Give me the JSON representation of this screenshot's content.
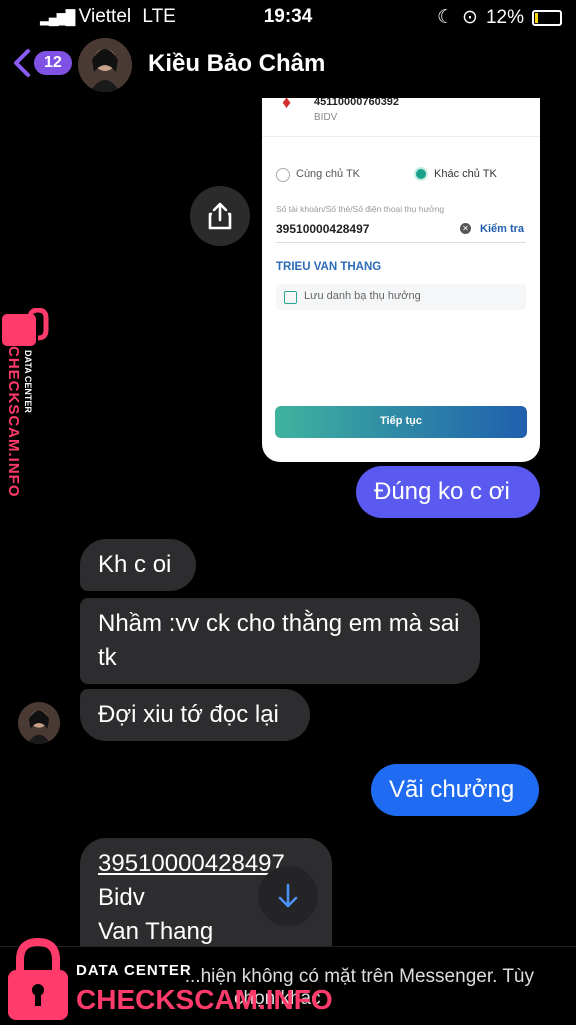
{
  "status_bar": {
    "carrier": "Viettel",
    "network": "LTE",
    "time": "19:34",
    "battery": "12%"
  },
  "header": {
    "back_count": "12",
    "contact_name": "Kiều Bảo Châm"
  },
  "shared_image": {
    "top_account": "45110000760392",
    "top_bank": "BIDV",
    "option_same": "Cùng chủ TK",
    "option_other": "Khác chủ TK",
    "field_label": "Số tài khoản/Số thẻ/Số điện thoại thụ hưởng",
    "field_value": "39510000428497",
    "check_label": "Kiểm tra",
    "beneficiary_name": "TRIEU VAN THANG",
    "save_label": "Lưu danh bạ thụ hưởng",
    "continue_label": "Tiếp tục"
  },
  "messages": [
    {
      "id": "m1",
      "direction": "outgoing",
      "text": "Đúng ko c ơi"
    },
    {
      "id": "m2",
      "direction": "incoming",
      "text": "Kh c oi"
    },
    {
      "id": "m3",
      "direction": "incoming",
      "text": "Nhầm :vv ck cho thằng em mà sai tk"
    },
    {
      "id": "m4",
      "direction": "incoming",
      "text": "Đợi xiu tớ đọc lại"
    },
    {
      "id": "m5",
      "direction": "outgoing",
      "text": "Vãi chưởng"
    },
    {
      "id": "m6",
      "direction": "incoming",
      "lines": [
        "39510000428497",
        "Bidv",
        "Van Thang"
      ]
    }
  ],
  "notice": {
    "text": "...hiện không có mặt trên Messenger. Tùy",
    "text2": "chọn khác"
  },
  "watermark": {
    "label": "DATA CENTER",
    "site": "CHECKSCAM.INFO"
  },
  "colors": {
    "outgoing_purple": "#5a5af1",
    "outgoing_blue": "#1f6cf2",
    "incoming": "#2d2d2f",
    "badge": "#7f52e5",
    "watermark": "#ff3b6b"
  },
  "icons": [
    "back-chevron-icon",
    "share-icon",
    "scroll-down-arrow-icon",
    "lock-icon"
  ]
}
